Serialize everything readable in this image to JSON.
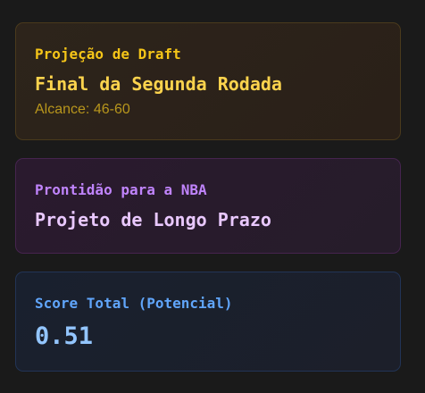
{
  "draft_projection": {
    "label": "Projeção de Draft",
    "value": "Final da Segunda Rodada",
    "range": "Alcance: 46-60",
    "color": "#f5c518"
  },
  "nba_readiness": {
    "label": "Prontidão para a NBA",
    "value": "Projeto de Longo Prazo",
    "color": "#c084fc"
  },
  "total_score": {
    "label": "Score Total (Potencial)",
    "value": "0.51",
    "color": "#60a5fa"
  }
}
